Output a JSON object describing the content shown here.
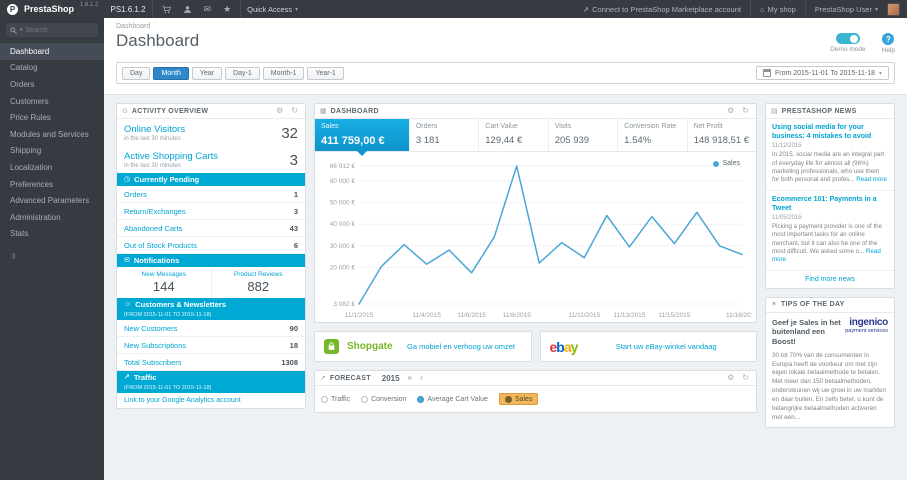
{
  "icons": {
    "gear": "⚙",
    "refresh": "↻",
    "caret_down": "▾",
    "star": "★",
    "envelope": "✉",
    "activity": "⊙",
    "grid": "▦",
    "clock": "◷",
    "users": "☺",
    "trend": "↗",
    "news": "▤",
    "bulb": "✶",
    "external": "⇗",
    "home": "⌂",
    "collapse": "‖",
    "prev_fast": "«",
    "prev": "‹",
    "question": "?"
  },
  "colors": {
    "accent": "#00a3d3",
    "section_bar": "#00a9d4",
    "primary_button": "#2e88c9",
    "kpi_active": "#0d95cc",
    "chart_line": "#4aa6d8",
    "forecast_selected": "#f0b75e",
    "shopgate_green": "#76b82a",
    "ingenico_blue": "#26358c",
    "ebay": [
      "#e53238",
      "#0064d2",
      "#f5af02",
      "#86b817"
    ]
  },
  "topbar": {
    "brand": "PrestaShop",
    "version": "1.6.1.2",
    "shop_name": "PS1.6.1.2",
    "quick_access": "Quick Access",
    "marketplace": "Connect to PrestaShop Marketplace account",
    "my_shop": "My shop",
    "user": "PrestaShop User"
  },
  "sidebar": {
    "search_placeholder": "Search",
    "items": [
      {
        "label": "Dashboard"
      },
      {
        "label": "Catalog"
      },
      {
        "label": "Orders"
      },
      {
        "label": "Customers"
      },
      {
        "label": "Price Rules"
      },
      {
        "label": "Modules and Services"
      },
      {
        "label": "Shipping"
      },
      {
        "label": "Localization"
      },
      {
        "label": "Preferences"
      },
      {
        "label": "Advanced Parameters"
      },
      {
        "label": "Administration"
      },
      {
        "label": "Stats"
      }
    ]
  },
  "page": {
    "breadcrumb": "Dashboard",
    "title": "Dashboard",
    "demo_label": "Demo mode",
    "help_label": "Help"
  },
  "filters": {
    "buttons": [
      "Day",
      "Month",
      "Year",
      "Day-1",
      "Month-1",
      "Year-1"
    ],
    "active": "Month",
    "date_range": "From 2015-11-01 To 2015-11-18"
  },
  "activity": {
    "title": "ACTIVITY OVERVIEW",
    "stats": [
      {
        "label": "Online Visitors",
        "sub": "in the last 30 minutes",
        "value": "32"
      },
      {
        "label": "Active Shopping Carts",
        "sub": "in the last 30 minutes",
        "value": "3"
      }
    ],
    "pending": {
      "title": "Currently Pending",
      "rows": [
        {
          "label": "Orders",
          "value": "1"
        },
        {
          "label": "Return/Exchanges",
          "value": "3"
        },
        {
          "label": "Abandoned Carts",
          "value": "43"
        },
        {
          "label": "Out of Stock Products",
          "value": "6"
        }
      ]
    },
    "notifications": {
      "title": "Notifications",
      "cols": [
        {
          "label": "New Messages",
          "value": "144"
        },
        {
          "label": "Product Reviews",
          "value": "882"
        }
      ]
    },
    "customers": {
      "title": "Customers & Newsletters",
      "subtitle": "(FROM 2015-11-01 TO 2015-11-18)",
      "rows": [
        {
          "label": "New Customers",
          "value": "90"
        },
        {
          "label": "New Subscriptions",
          "value": "18"
        },
        {
          "label": "Total Subscribers",
          "value": "1308"
        }
      ]
    },
    "traffic": {
      "title": "Traffic",
      "subtitle": "(FROM 2015-11-01 TO 2015-11-18)",
      "link": "Link to your Google Analytics account"
    }
  },
  "dashboard_panel": {
    "title": "DASHBOARD",
    "legend": "Sales",
    "kpis": [
      {
        "label": "Sales",
        "value": "411 759,00 €"
      },
      {
        "label": "Orders",
        "value": "3 181"
      },
      {
        "label": "Cart Value",
        "value": "129,44 €"
      },
      {
        "label": "Visits",
        "value": "205 939"
      },
      {
        "label": "Conversion Rate",
        "value": "1.54%"
      },
      {
        "label": "Net Profit",
        "value": "148 918,51 €"
      }
    ]
  },
  "chart_data": {
    "type": "line",
    "title": "Sales",
    "series": [
      {
        "name": "Sales"
      }
    ],
    "x": [
      "11/1",
      "11/2",
      "11/3",
      "11/4",
      "11/5",
      "11/6",
      "11/7",
      "11/8",
      "11/9",
      "11/10",
      "11/11",
      "11/12",
      "11/13",
      "11/14",
      "11/15",
      "11/16",
      "11/17",
      "11/18"
    ],
    "values": [
      3082,
      20500,
      30500,
      21500,
      28000,
      17500,
      34000,
      66912,
      22000,
      31500,
      24500,
      44000,
      29500,
      43500,
      31000,
      45500,
      30000,
      26000
    ],
    "ymin": 3082,
    "ymax": 66912,
    "grid": true,
    "legend_position": "top-right",
    "line_color": "#4aa6d8",
    "yticks": [
      {
        "v": 66912,
        "label": "66 912 €"
      },
      {
        "v": 60000,
        "label": "60 000 €"
      },
      {
        "v": 50000,
        "label": "50 000 €"
      },
      {
        "v": 40000,
        "label": "40 000 €"
      },
      {
        "v": 30000,
        "label": "30 000 €"
      },
      {
        "v": 20000,
        "label": "20 000 €"
      },
      {
        "v": 3082,
        "label": "3 082 €"
      }
    ],
    "xticks": [
      {
        "day": 1,
        "label": "11/1/2015"
      },
      {
        "day": 4,
        "label": "11/4/2015"
      },
      {
        "day": 6,
        "label": "11/6/2015"
      },
      {
        "day": 8,
        "label": "11/8/2015"
      },
      {
        "day": 11,
        "label": "11/11/2015"
      },
      {
        "day": 13,
        "label": "11/13/2015"
      },
      {
        "day": 15,
        "label": "11/15/2015"
      },
      {
        "day": 18,
        "label": "11/18/2015"
      }
    ]
  },
  "modules": [
    {
      "name": "Shopgate",
      "link": "Ga mobiel en verhoog uw omzet"
    },
    {
      "name": "ebay",
      "letters": [
        {
          "ch": "e"
        },
        {
          "ch": "b"
        },
        {
          "ch": "a"
        },
        {
          "ch": "y"
        }
      ],
      "link": "Start uw eBay-winkel vandaag"
    }
  ],
  "forecast": {
    "title": "FORECAST",
    "year": "2015",
    "options": [
      "Traffic",
      "Conversion",
      "Average Cart Value",
      "Sales"
    ],
    "selected": "Sales"
  },
  "news": {
    "title": "PRESTASHOP NEWS",
    "read_more": "Read more",
    "more": "Find more news",
    "articles": [
      {
        "title": "Using social media for your business: 4 mistakes to avoid",
        "date": "11/12/2015",
        "excerpt": "In 2015, social media are an integral part of everyday life for almost all (96%) marketing professionals, who use them for both personal and profes..."
      },
      {
        "title": "Ecommerce 101: Payments in a Tweet",
        "date": "11/05/2015",
        "excerpt": "Picking a payment provider is one of the most important tasks for an online merchant, but it can also be one of the most difficult. We asked some o..."
      }
    ]
  },
  "tips": {
    "title": "TIPS OF THE DAY",
    "headline": "Geef je Sales in het buitenland een Boost!",
    "brand": "ingenico",
    "brand_sub": "payment services",
    "body": "30 tot 70% van de consumenten in Europa heeft de voorkeur om met zijn eigen lokale betaalmethode te betalen. Met meer dan 150 betaalmethoden, ondersteunen wij uw groei in uw markten en daar buiten. En zelfs beter, u kunt de belangrijke betaalmethoden activeren met een..."
  }
}
